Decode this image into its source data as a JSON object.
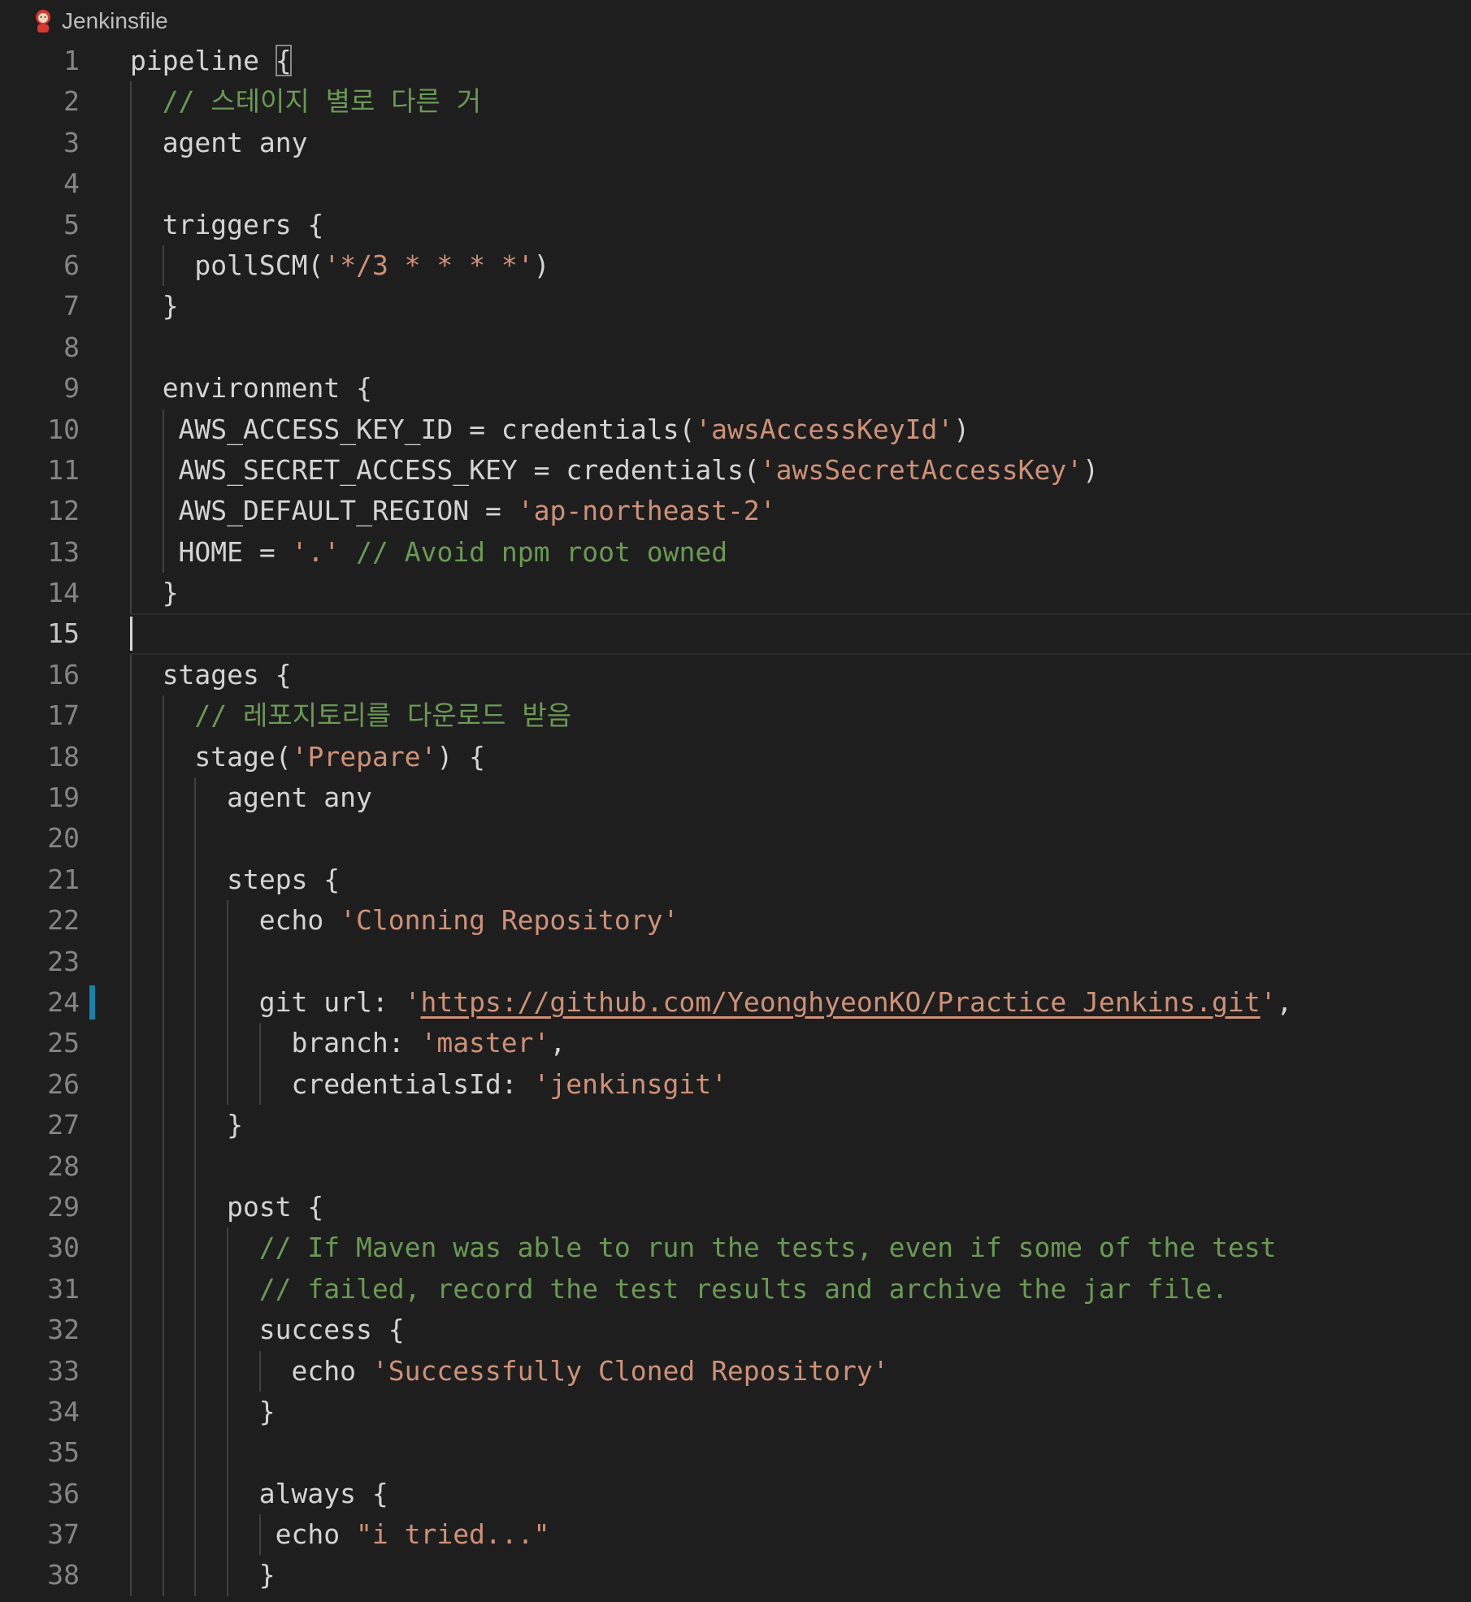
{
  "breadcrumb": {
    "file_name": "Jenkinsfile",
    "icon": "jenkins-icon"
  },
  "editor": {
    "current_line": 15,
    "modified_line": 24,
    "lines": [
      {
        "n": "1",
        "indent": 0,
        "guides": 0,
        "tokens": [
          {
            "t": "pipeline "
          },
          {
            "t": "{",
            "c": "br-match"
          }
        ]
      },
      {
        "n": "2",
        "indent": 2,
        "guides": 1,
        "tokens": [
          {
            "t": "// 스테이지 별로 다른 거",
            "c": "cm"
          }
        ]
      },
      {
        "n": "3",
        "indent": 2,
        "guides": 1,
        "tokens": [
          {
            "t": "agent any"
          }
        ]
      },
      {
        "n": "4",
        "indent": 0,
        "guides": 1,
        "tokens": []
      },
      {
        "n": "5",
        "indent": 2,
        "guides": 1,
        "tokens": [
          {
            "t": "triggers {"
          }
        ]
      },
      {
        "n": "6",
        "indent": 4,
        "guides": 2,
        "tokens": [
          {
            "t": "pollSCM("
          },
          {
            "t": "'*/3 * * * *'",
            "c": "st"
          },
          {
            "t": ")"
          }
        ]
      },
      {
        "n": "7",
        "indent": 2,
        "guides": 1,
        "tokens": [
          {
            "t": "}"
          }
        ]
      },
      {
        "n": "8",
        "indent": 0,
        "guides": 1,
        "tokens": []
      },
      {
        "n": "9",
        "indent": 2,
        "guides": 1,
        "tokens": [
          {
            "t": "environment {"
          }
        ]
      },
      {
        "n": "10",
        "indent": 3,
        "guides": 2,
        "tokens": [
          {
            "t": "AWS_ACCESS_KEY_ID = credentials("
          },
          {
            "t": "'awsAccessKeyId'",
            "c": "st"
          },
          {
            "t": ")"
          }
        ]
      },
      {
        "n": "11",
        "indent": 3,
        "guides": 2,
        "tokens": [
          {
            "t": "AWS_SECRET_ACCESS_KEY = credentials("
          },
          {
            "t": "'awsSecretAccessKey'",
            "c": "st"
          },
          {
            "t": ")"
          }
        ]
      },
      {
        "n": "12",
        "indent": 3,
        "guides": 2,
        "tokens": [
          {
            "t": "AWS_DEFAULT_REGION = "
          },
          {
            "t": "'ap-northeast-2'",
            "c": "st"
          }
        ]
      },
      {
        "n": "13",
        "indent": 3,
        "guides": 2,
        "tokens": [
          {
            "t": "HOME = "
          },
          {
            "t": "'.'",
            "c": "st"
          },
          {
            "t": " "
          },
          {
            "t": "// Avoid npm root owned",
            "c": "cm"
          }
        ]
      },
      {
        "n": "14",
        "indent": 2,
        "guides": 1,
        "tokens": [
          {
            "t": "}"
          }
        ]
      },
      {
        "n": "15",
        "indent": 0,
        "guides": 0,
        "tokens": []
      },
      {
        "n": "16",
        "indent": 2,
        "guides": 1,
        "tokens": [
          {
            "t": "stages {"
          }
        ]
      },
      {
        "n": "17",
        "indent": 4,
        "guides": 2,
        "tokens": [
          {
            "t": "// 레포지토리를 다운로드 받음",
            "c": "cm"
          }
        ]
      },
      {
        "n": "18",
        "indent": 4,
        "guides": 2,
        "tokens": [
          {
            "t": "stage("
          },
          {
            "t": "'Prepare'",
            "c": "st"
          },
          {
            "t": ") {"
          }
        ]
      },
      {
        "n": "19",
        "indent": 6,
        "guides": 3,
        "tokens": [
          {
            "t": "agent any"
          }
        ]
      },
      {
        "n": "20",
        "indent": 0,
        "guides": 3,
        "tokens": []
      },
      {
        "n": "21",
        "indent": 6,
        "guides": 3,
        "tokens": [
          {
            "t": "steps {"
          }
        ]
      },
      {
        "n": "22",
        "indent": 8,
        "guides": 4,
        "tokens": [
          {
            "t": "echo "
          },
          {
            "t": "'Clonning Repository'",
            "c": "st"
          }
        ]
      },
      {
        "n": "23",
        "indent": 0,
        "guides": 4,
        "tokens": []
      },
      {
        "n": "24",
        "indent": 8,
        "guides": 4,
        "tokens": [
          {
            "t": "git url: "
          },
          {
            "t": "'",
            "c": "st"
          },
          {
            "t": "https://github.com/YeonghyeonKO/Practice_Jenkins.git",
            "c": "lk"
          },
          {
            "t": "'",
            "c": "st"
          },
          {
            "t": ","
          }
        ]
      },
      {
        "n": "25",
        "indent": 10,
        "guides": 5,
        "tokens": [
          {
            "t": "branch: "
          },
          {
            "t": "'master'",
            "c": "st"
          },
          {
            "t": ","
          }
        ]
      },
      {
        "n": "26",
        "indent": 10,
        "guides": 5,
        "tokens": [
          {
            "t": "credentialsId: "
          },
          {
            "t": "'jenkinsgit'",
            "c": "st"
          }
        ]
      },
      {
        "n": "27",
        "indent": 6,
        "guides": 3,
        "tokens": [
          {
            "t": "}"
          }
        ]
      },
      {
        "n": "28",
        "indent": 0,
        "guides": 3,
        "tokens": []
      },
      {
        "n": "29",
        "indent": 6,
        "guides": 3,
        "tokens": [
          {
            "t": "post {"
          }
        ]
      },
      {
        "n": "30",
        "indent": 8,
        "guides": 4,
        "tokens": [
          {
            "t": "// If Maven was able to run the tests, even if some of the test",
            "c": "cm"
          }
        ]
      },
      {
        "n": "31",
        "indent": 8,
        "guides": 4,
        "tokens": [
          {
            "t": "// failed, record the test results and archive the jar file.",
            "c": "cm"
          }
        ]
      },
      {
        "n": "32",
        "indent": 8,
        "guides": 4,
        "tokens": [
          {
            "t": "success {"
          }
        ]
      },
      {
        "n": "33",
        "indent": 10,
        "guides": 5,
        "tokens": [
          {
            "t": "echo "
          },
          {
            "t": "'Successfully Cloned Repository'",
            "c": "st"
          }
        ]
      },
      {
        "n": "34",
        "indent": 8,
        "guides": 4,
        "tokens": [
          {
            "t": "}"
          }
        ]
      },
      {
        "n": "35",
        "indent": 0,
        "guides": 4,
        "tokens": []
      },
      {
        "n": "36",
        "indent": 8,
        "guides": 4,
        "tokens": [
          {
            "t": "always {"
          }
        ]
      },
      {
        "n": "37",
        "indent": 9,
        "guides": 5,
        "tokens": [
          {
            "t": "echo "
          },
          {
            "t": "\"i tried...\"",
            "c": "st"
          }
        ]
      },
      {
        "n": "38",
        "indent": 8,
        "guides": 4,
        "tokens": [
          {
            "t": "}"
          }
        ]
      }
    ]
  }
}
